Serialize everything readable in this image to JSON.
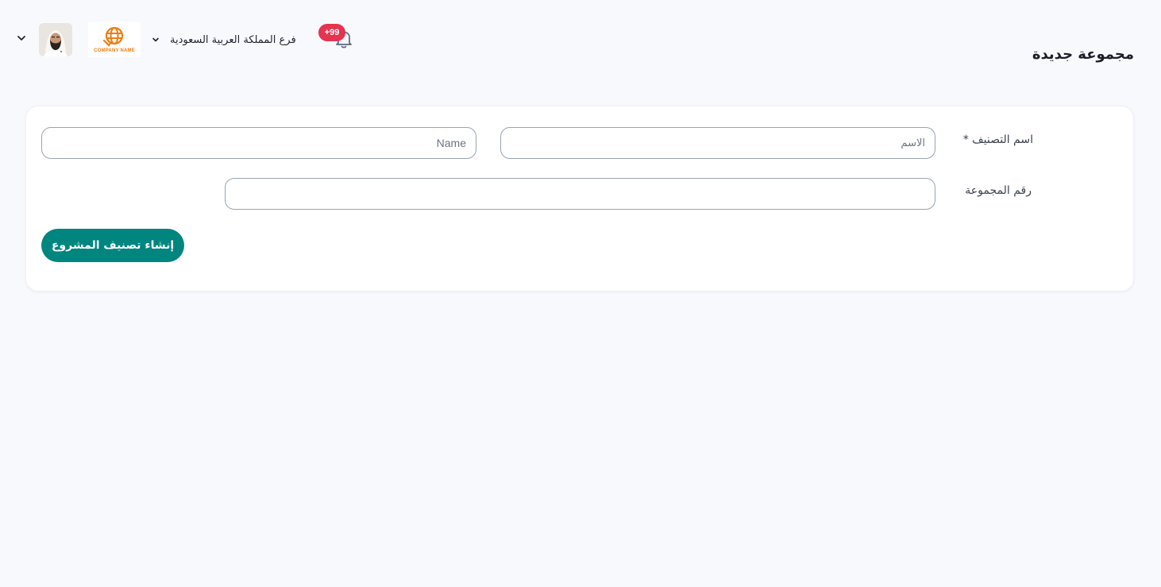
{
  "header": {
    "branch_label": "فرع المملكة العربية السعودية",
    "notification_count": "+99",
    "company_logo_text": "COMPANY NAME"
  },
  "page": {
    "title": "مجموعة جديدة"
  },
  "form": {
    "category_name_label": "اسم التصنيف *",
    "arabic_name_placeholder": "الاسم",
    "english_name_placeholder": "Name",
    "group_number_label": "رقم المجموعة",
    "group_number_value": "",
    "submit_label": "إنشاء تصنيف المشروع"
  },
  "colors": {
    "accent": "#00857f",
    "badge": "#e4344f",
    "logo": "#ee7d12",
    "background": "#f8f9fd"
  },
  "icons": {
    "user_menu": "chevron-down-icon",
    "branch_menu": "chevron-down-icon",
    "notifications": "bell-icon",
    "logo": "globe-icon"
  }
}
